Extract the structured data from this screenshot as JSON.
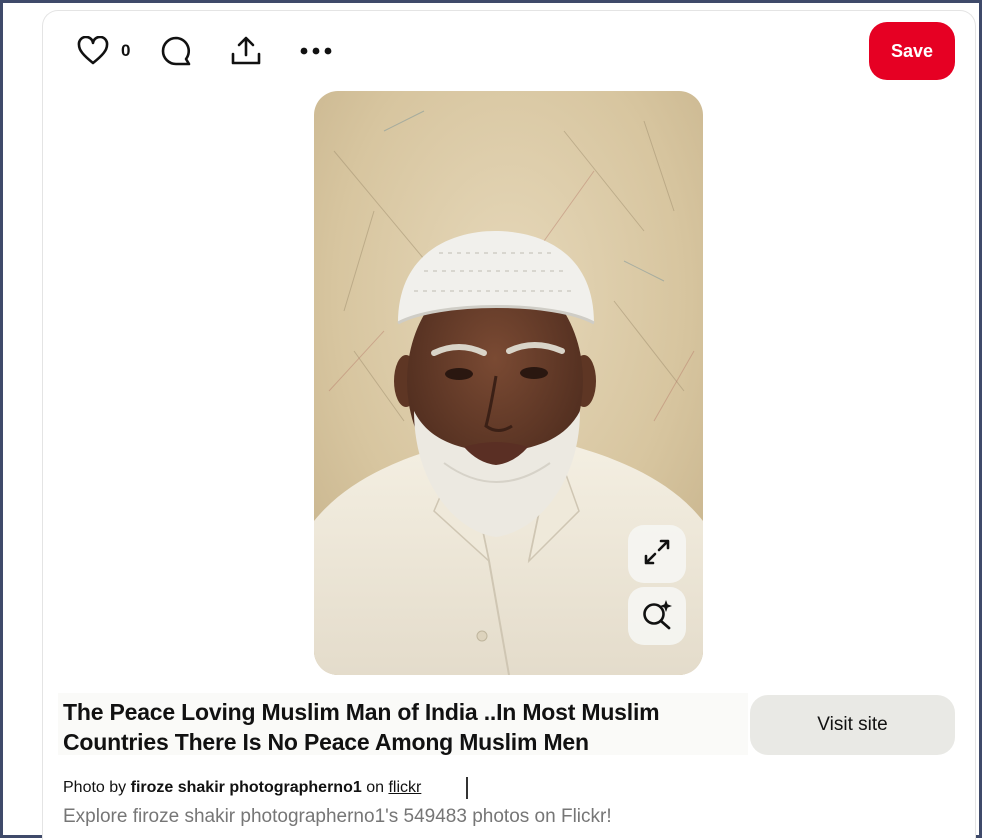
{
  "toolbar": {
    "like_count": "0",
    "save_label": "Save"
  },
  "pin": {
    "title": "The Peace Loving Muslim Man of India ..In Most Muslim Countries There Is No Peace Among Muslim Men",
    "visit_label": "Visit site",
    "photo_prefix": "Photo by",
    "author": "firoze shakir photographerno1",
    "on_text": "on",
    "source": "flickr",
    "description": "Explore firoze shakir photographerno1's 549483 photos on Flickr!"
  },
  "colors": {
    "save_button": "#e60023",
    "visit_button": "#e9e9e5",
    "frame_border": "#3f4a6a"
  },
  "icons": [
    "heart-icon",
    "comment-icon",
    "share-icon",
    "more-icon",
    "expand-icon",
    "visual-search-icon"
  ]
}
